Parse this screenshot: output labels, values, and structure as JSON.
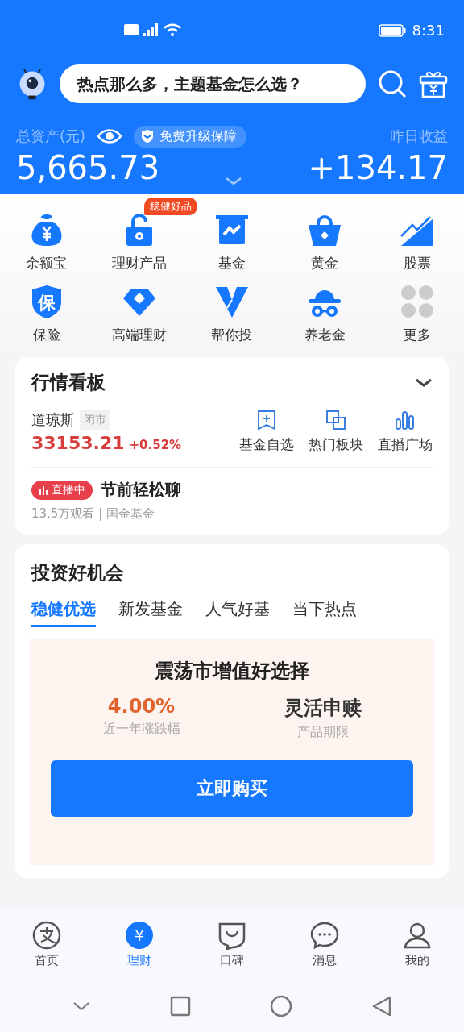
{
  "status_bar": {
    "time": "8:31"
  },
  "header": {
    "search_prompt": "热点那么多，主题基金怎么选？"
  },
  "assets": {
    "label": "总资产(元)",
    "badge": "免费升级保障",
    "total": "5,665.73",
    "yesterday_label": "昨日收益",
    "yesterday": "+134.17"
  },
  "shortcuts": [
    {
      "label": "余额宝"
    },
    {
      "label": "理财产品",
      "tag": "稳健好品"
    },
    {
      "label": "基金"
    },
    {
      "label": "黄金"
    },
    {
      "label": "股票"
    },
    {
      "label": "保险",
      "glyph": "保"
    },
    {
      "label": "高端理财"
    },
    {
      "label": "帮你投"
    },
    {
      "label": "养老金"
    },
    {
      "label": "更多"
    }
  ],
  "market": {
    "title": "行情看板",
    "index_name": "道琼斯",
    "index_status": "闭市",
    "index_value": "33153.21",
    "index_change": "+0.52%",
    "links": [
      "基金自选",
      "热门板块",
      "直播广场"
    ],
    "live": {
      "badge": "直播中",
      "title": "节前轻松聊",
      "meta": "13.5万观看 | 国金基金"
    }
  },
  "opportunities": {
    "title": "投资好机会",
    "tabs": [
      {
        "label": "稳健优选",
        "selected": true
      },
      {
        "label": "新发基金",
        "selected": false
      },
      {
        "label": "人气好基",
        "selected": false
      },
      {
        "label": "当下热点",
        "selected": false
      }
    ],
    "feature": {
      "title": "震荡市增值好选择",
      "stats": [
        {
          "kind": "rate",
          "value": "4.00%",
          "label": "近一年涨跌幅"
        },
        {
          "kind": "text",
          "value": "灵活申赎",
          "label": "产品期限"
        }
      ],
      "button": "立即购买"
    }
  },
  "tab_bar": [
    {
      "label": "首页",
      "selected": false
    },
    {
      "label": "理财",
      "selected": true,
      "glyph": "¥"
    },
    {
      "label": "口碑",
      "selected": false
    },
    {
      "label": "消息",
      "selected": false
    },
    {
      "label": "我的",
      "selected": false
    }
  ]
}
